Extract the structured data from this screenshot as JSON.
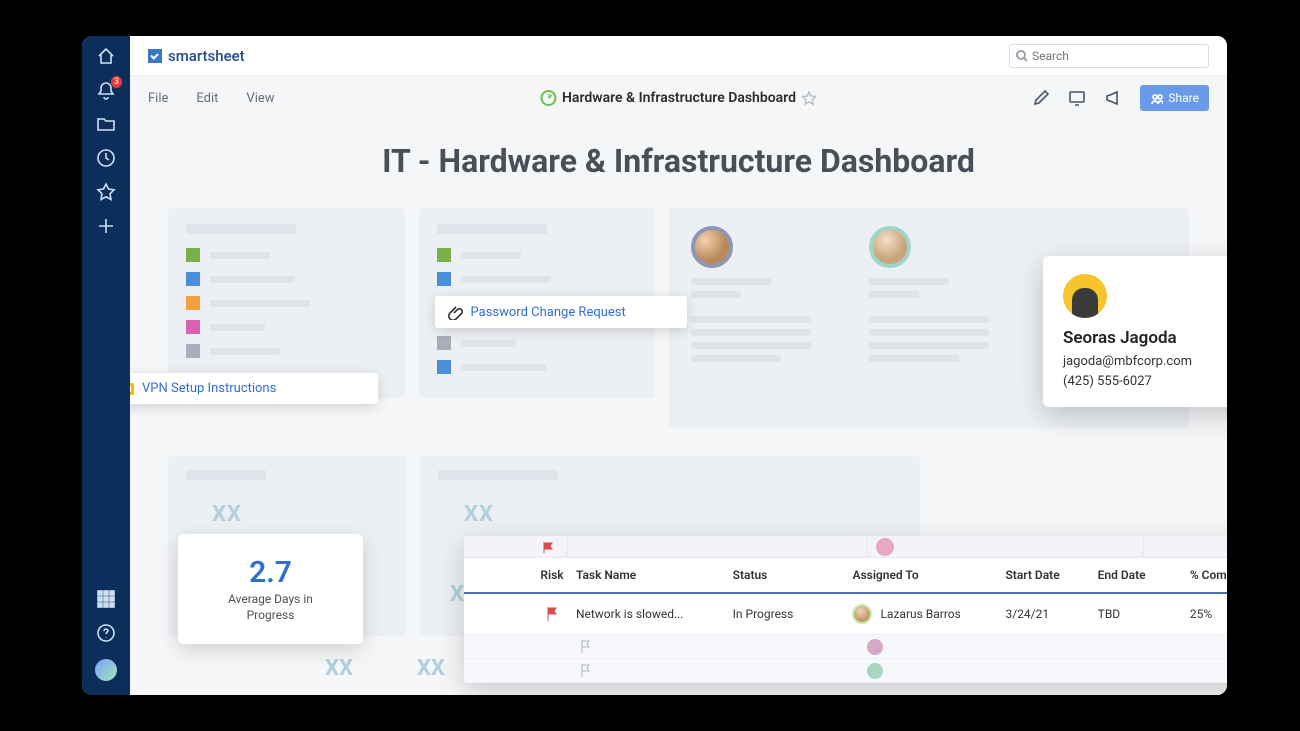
{
  "brand": "smartsheet",
  "search": {
    "placeholder": "Search"
  },
  "rail": {
    "notifications_badge": "3"
  },
  "menubar": {
    "file": "File",
    "edit": "Edit",
    "view": "View"
  },
  "doc_title": "Hardware & Infrastructure Dashboard",
  "share_label": "Share",
  "page_heading": "IT - Hardware & Infrastructure Dashboard",
  "tags": {
    "vpn": "VPN Setup Instructions",
    "pwd": "Password Change Request"
  },
  "contact": {
    "name": "Seoras Jagoda",
    "email": "jagoda@mbfcorp.com",
    "phone": "(425) 555-6027"
  },
  "stat": {
    "value": "2.7",
    "label_l1": "Average Days in",
    "label_l2": "Progress"
  },
  "placeholder_text": "XX",
  "sheet": {
    "columns": {
      "risk": "Risk",
      "task": "Task Name",
      "status": "Status",
      "assigned": "Assigned To",
      "start": "Start Date",
      "end": "End Date",
      "pct": "% Complete"
    },
    "row": {
      "task": "Network is slowed...",
      "status": "In Progress",
      "assigned": "Lazarus Barros",
      "start": "3/24/21",
      "end": "TBD",
      "pct": "25%"
    }
  },
  "colors": {
    "green": "#7bb04b",
    "blue": "#4a8fd8",
    "orange": "#f2a13e",
    "magenta": "#d861b0",
    "grey": "#a9afba",
    "cyanX": "#b2cfde"
  }
}
